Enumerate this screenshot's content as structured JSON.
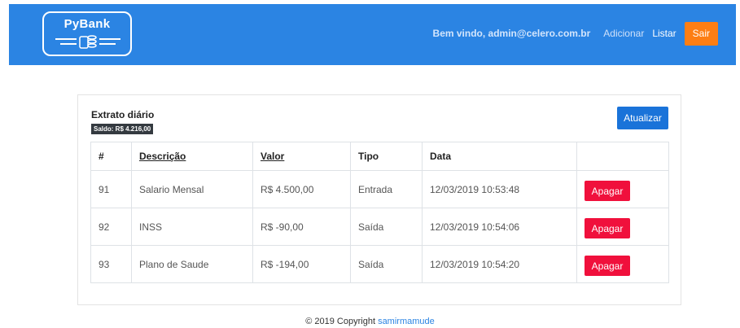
{
  "header": {
    "logo_text": "PyBank",
    "welcome": "Bem vindo, admin@celero.com.br",
    "nav": {
      "add": "Adicionar",
      "list": "Listar"
    },
    "logout": "Sair",
    "colors": {
      "bar": "#2b84e3",
      "logout": "#fd7e14"
    }
  },
  "statement": {
    "title": "Extrato diário",
    "balance": "Saldo: R$ 4.216,00",
    "refresh_label": "Atualizar",
    "columns": [
      "#",
      "Descrição",
      "Valor",
      "Tipo",
      "Data",
      ""
    ],
    "rows": [
      {
        "id": "91",
        "description": "Salario Mensal",
        "value": "R$ 4.500,00",
        "type": "Entrada",
        "date": "12/03/2019 10:53:48",
        "action": "Apagar"
      },
      {
        "id": "92",
        "description": "INSS",
        "value": "R$ -90,00",
        "type": "Saída",
        "date": "12/03/2019 10:54:06",
        "action": "Apagar"
      },
      {
        "id": "93",
        "description": "Plano de Saude",
        "value": "R$ -194,00",
        "type": "Saída",
        "date": "12/03/2019 10:54:20",
        "action": "Apagar"
      }
    ]
  },
  "footer": {
    "copyright": "© 2019 Copyright",
    "author": "samirmamude"
  }
}
